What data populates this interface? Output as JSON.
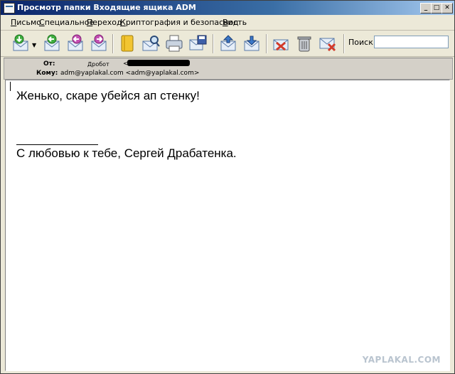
{
  "window": {
    "title": "Просмотр папки Входящие ящика ADM",
    "controls": {
      "minimize": "_",
      "maximize": "□",
      "close": "✕"
    }
  },
  "menu": [
    {
      "first": "П",
      "rest": "исьмо"
    },
    {
      "first": "С",
      "rest": "пециальное"
    },
    {
      "first": "П",
      "rest": "ереход"
    },
    {
      "first": "К",
      "rest": "риптография и безопасность"
    },
    {
      "first": "В",
      "rest": "ид"
    }
  ],
  "toolbar": {
    "icons": [
      "receive-icon",
      "reply-icon",
      "reply-all-icon",
      "forward-icon",
      "address-book-icon",
      "find-icon",
      "print-icon",
      "save-icon",
      "previous-icon",
      "next-icon",
      "mark-spam-icon",
      "delete-icon",
      "delete-forever-icon"
    ],
    "search_label": "Поиск:",
    "search_value": ""
  },
  "header": {
    "from_label": "От:",
    "from_name": "Дробот",
    "from_email_open": "<",
    "to_label": "Кому:",
    "to_value": "adm@yaplakal.com <adm@yaplakal.com>"
  },
  "message": {
    "line1": "Женько, скаре убейся ап стенку!",
    "signature_separator": "______________",
    "line2": "С любовью к тебе, Сергей Драбатенка."
  },
  "watermark": "YAPLAKAL.COM"
}
